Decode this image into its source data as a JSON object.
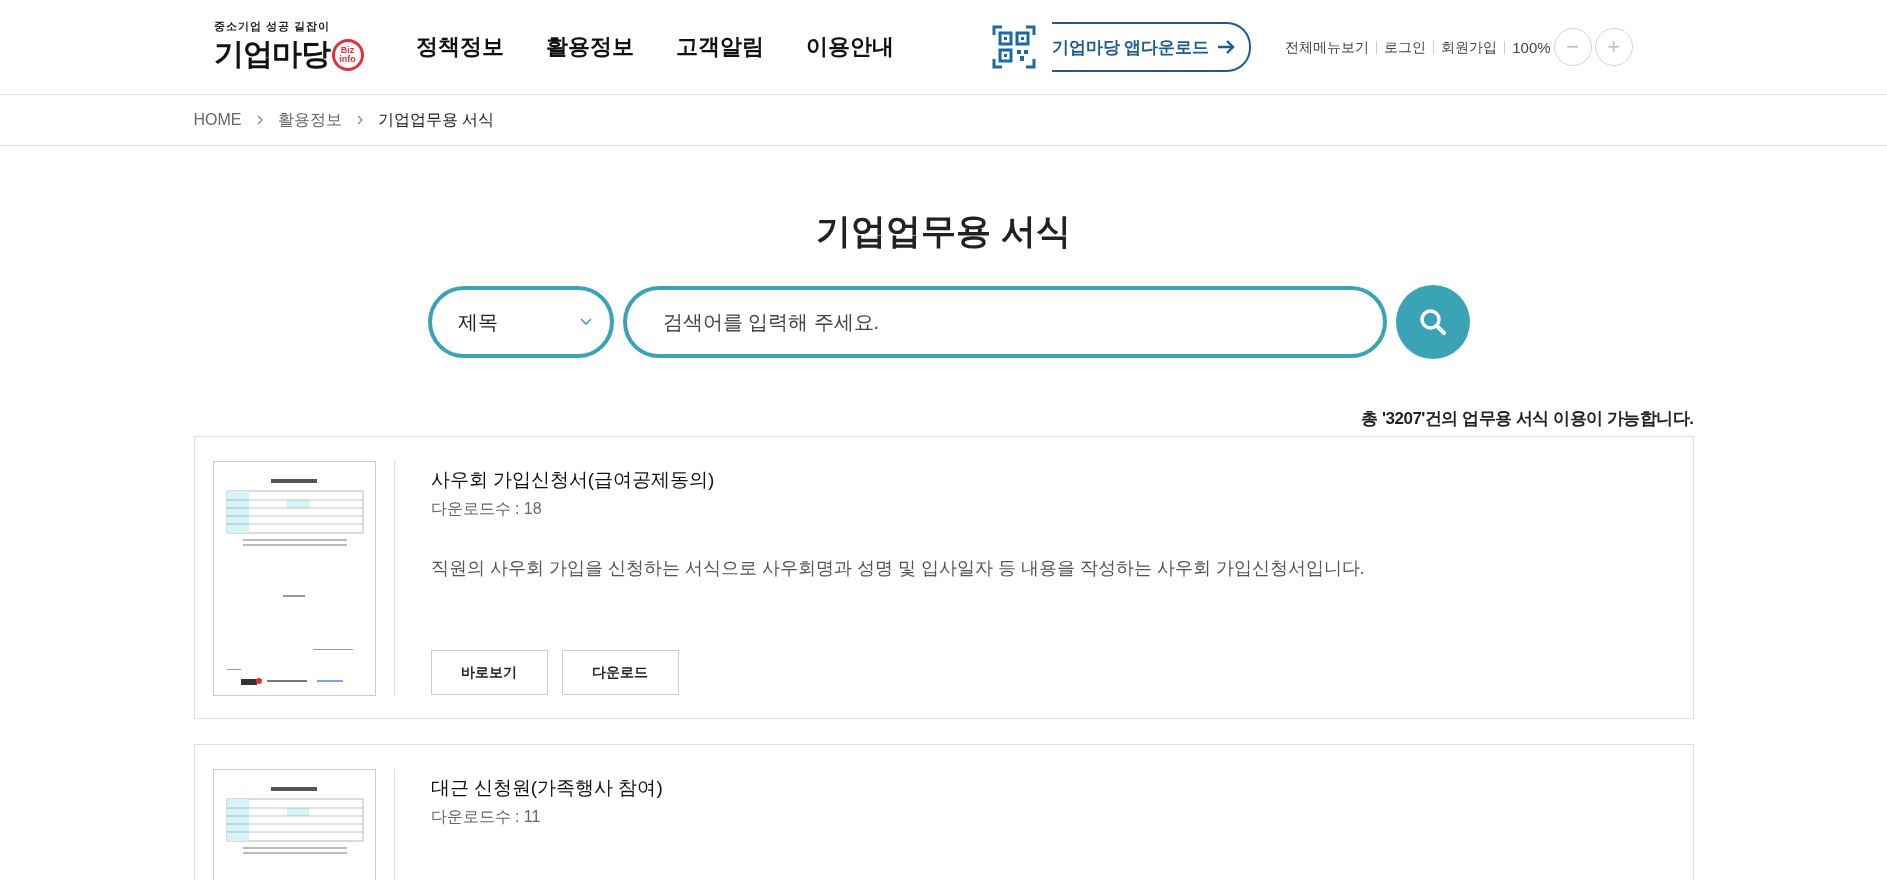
{
  "header": {
    "logo": {
      "tagline": "중소기업 성공 길잡이",
      "name": "기업마당",
      "badge_top": "Biz",
      "badge_bottom": "info"
    },
    "nav": [
      {
        "label": "정책정보"
      },
      {
        "label": "활용정보"
      },
      {
        "label": "고객알림"
      },
      {
        "label": "이용안내"
      }
    ],
    "app_download": "기업마당 앱다운로드",
    "links": [
      "전체메뉴보기",
      "로그인",
      "회원가입"
    ],
    "zoom": {
      "value": "100%",
      "minus": "−",
      "plus": "+"
    }
  },
  "breadcrumb": [
    "HOME",
    "활용정보",
    "기업업무용 서식"
  ],
  "title": "기업업무용 서식",
  "search": {
    "field": "제목",
    "placeholder": "검색어를 입력해 주세요."
  },
  "count": "총 '3207'건의 업무용 서식 이용이 가능합니다.",
  "forms": [
    {
      "title": "사우회 가입신청서(급여공제동의)",
      "downloads": "다운로드수 : 18",
      "description": "직원의 사우회 가입을 신청하는 서식으로 사우회명과 성명 및 입사일자 등 내용을 작성하는 사우회 가입신청서입니다.",
      "buttons": [
        "바로보기",
        "다운로드"
      ]
    },
    {
      "title": "대근 신청원(가족행사 참여)",
      "downloads": "다운로드수 : 11"
    }
  ]
}
